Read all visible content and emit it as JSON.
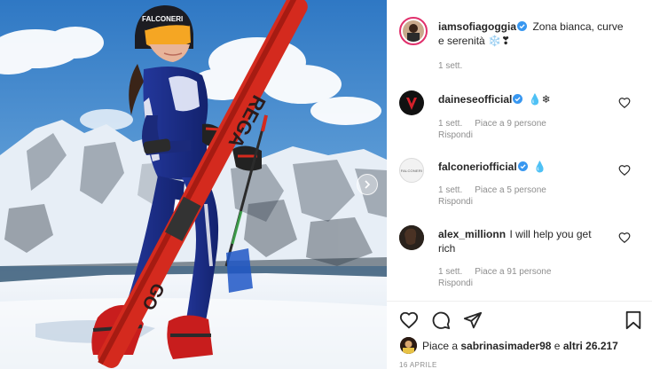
{
  "post": {
    "author": "iamsofiagoggia",
    "caption_line1": "Zona bianca, curve",
    "caption_line2": "e serenità ❄️❣",
    "time": "1 sett."
  },
  "photo": {
    "helmet_brand": "FALCONERI",
    "ski_text_upper": "REGA",
    "ski_text_lower": "GO"
  },
  "comments": [
    {
      "user": "daineseofficial",
      "text": "💧❄",
      "time": "1 sett.",
      "likes": "Piace a 9 persone",
      "reply": "Rispondi",
      "avatar_text": ""
    },
    {
      "user": "falconeriofficial",
      "text": "💧",
      "time": "1 sett.",
      "likes": "Piace a 5 persone",
      "reply": "Rispondi",
      "avatar_text": "FALCONERI"
    },
    {
      "user": "alex_millionn",
      "text_line1": "I will help you get",
      "text_line2": "rich",
      "time": "1 sett.",
      "likes": "Piace a 91 persone",
      "reply": "Rispondi"
    }
  ],
  "likes": {
    "prefix": "Piace a",
    "user": "sabrinasimader98",
    "middle": "e",
    "others": "altri 26.217"
  },
  "date": "16 APRILE",
  "colors": {
    "verified": "#3897f0",
    "suit_blue": "#1b2e8c",
    "ski_red": "#d42a1e",
    "sky": "#3a86c8"
  }
}
